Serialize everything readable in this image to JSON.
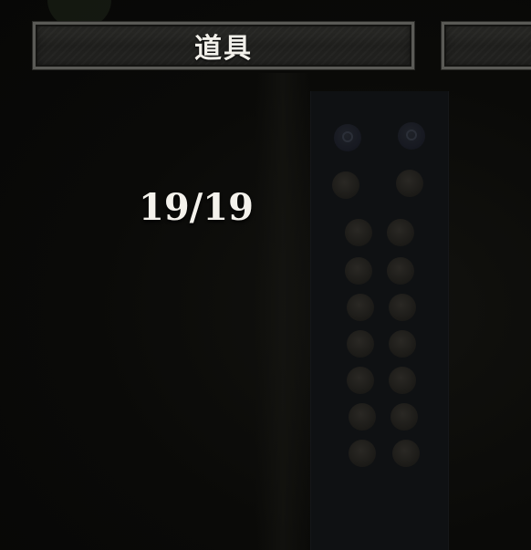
{
  "tabs": {
    "items_label": "道具",
    "next_label": ""
  },
  "inventory": {
    "count": "19/19"
  },
  "icons": {
    "slot": "orb-icon",
    "badge": "emblem-icon"
  },
  "colors": {
    "background": "#0b0b09",
    "tab_border": "#5a5a56",
    "text": "#f2f0ea"
  }
}
